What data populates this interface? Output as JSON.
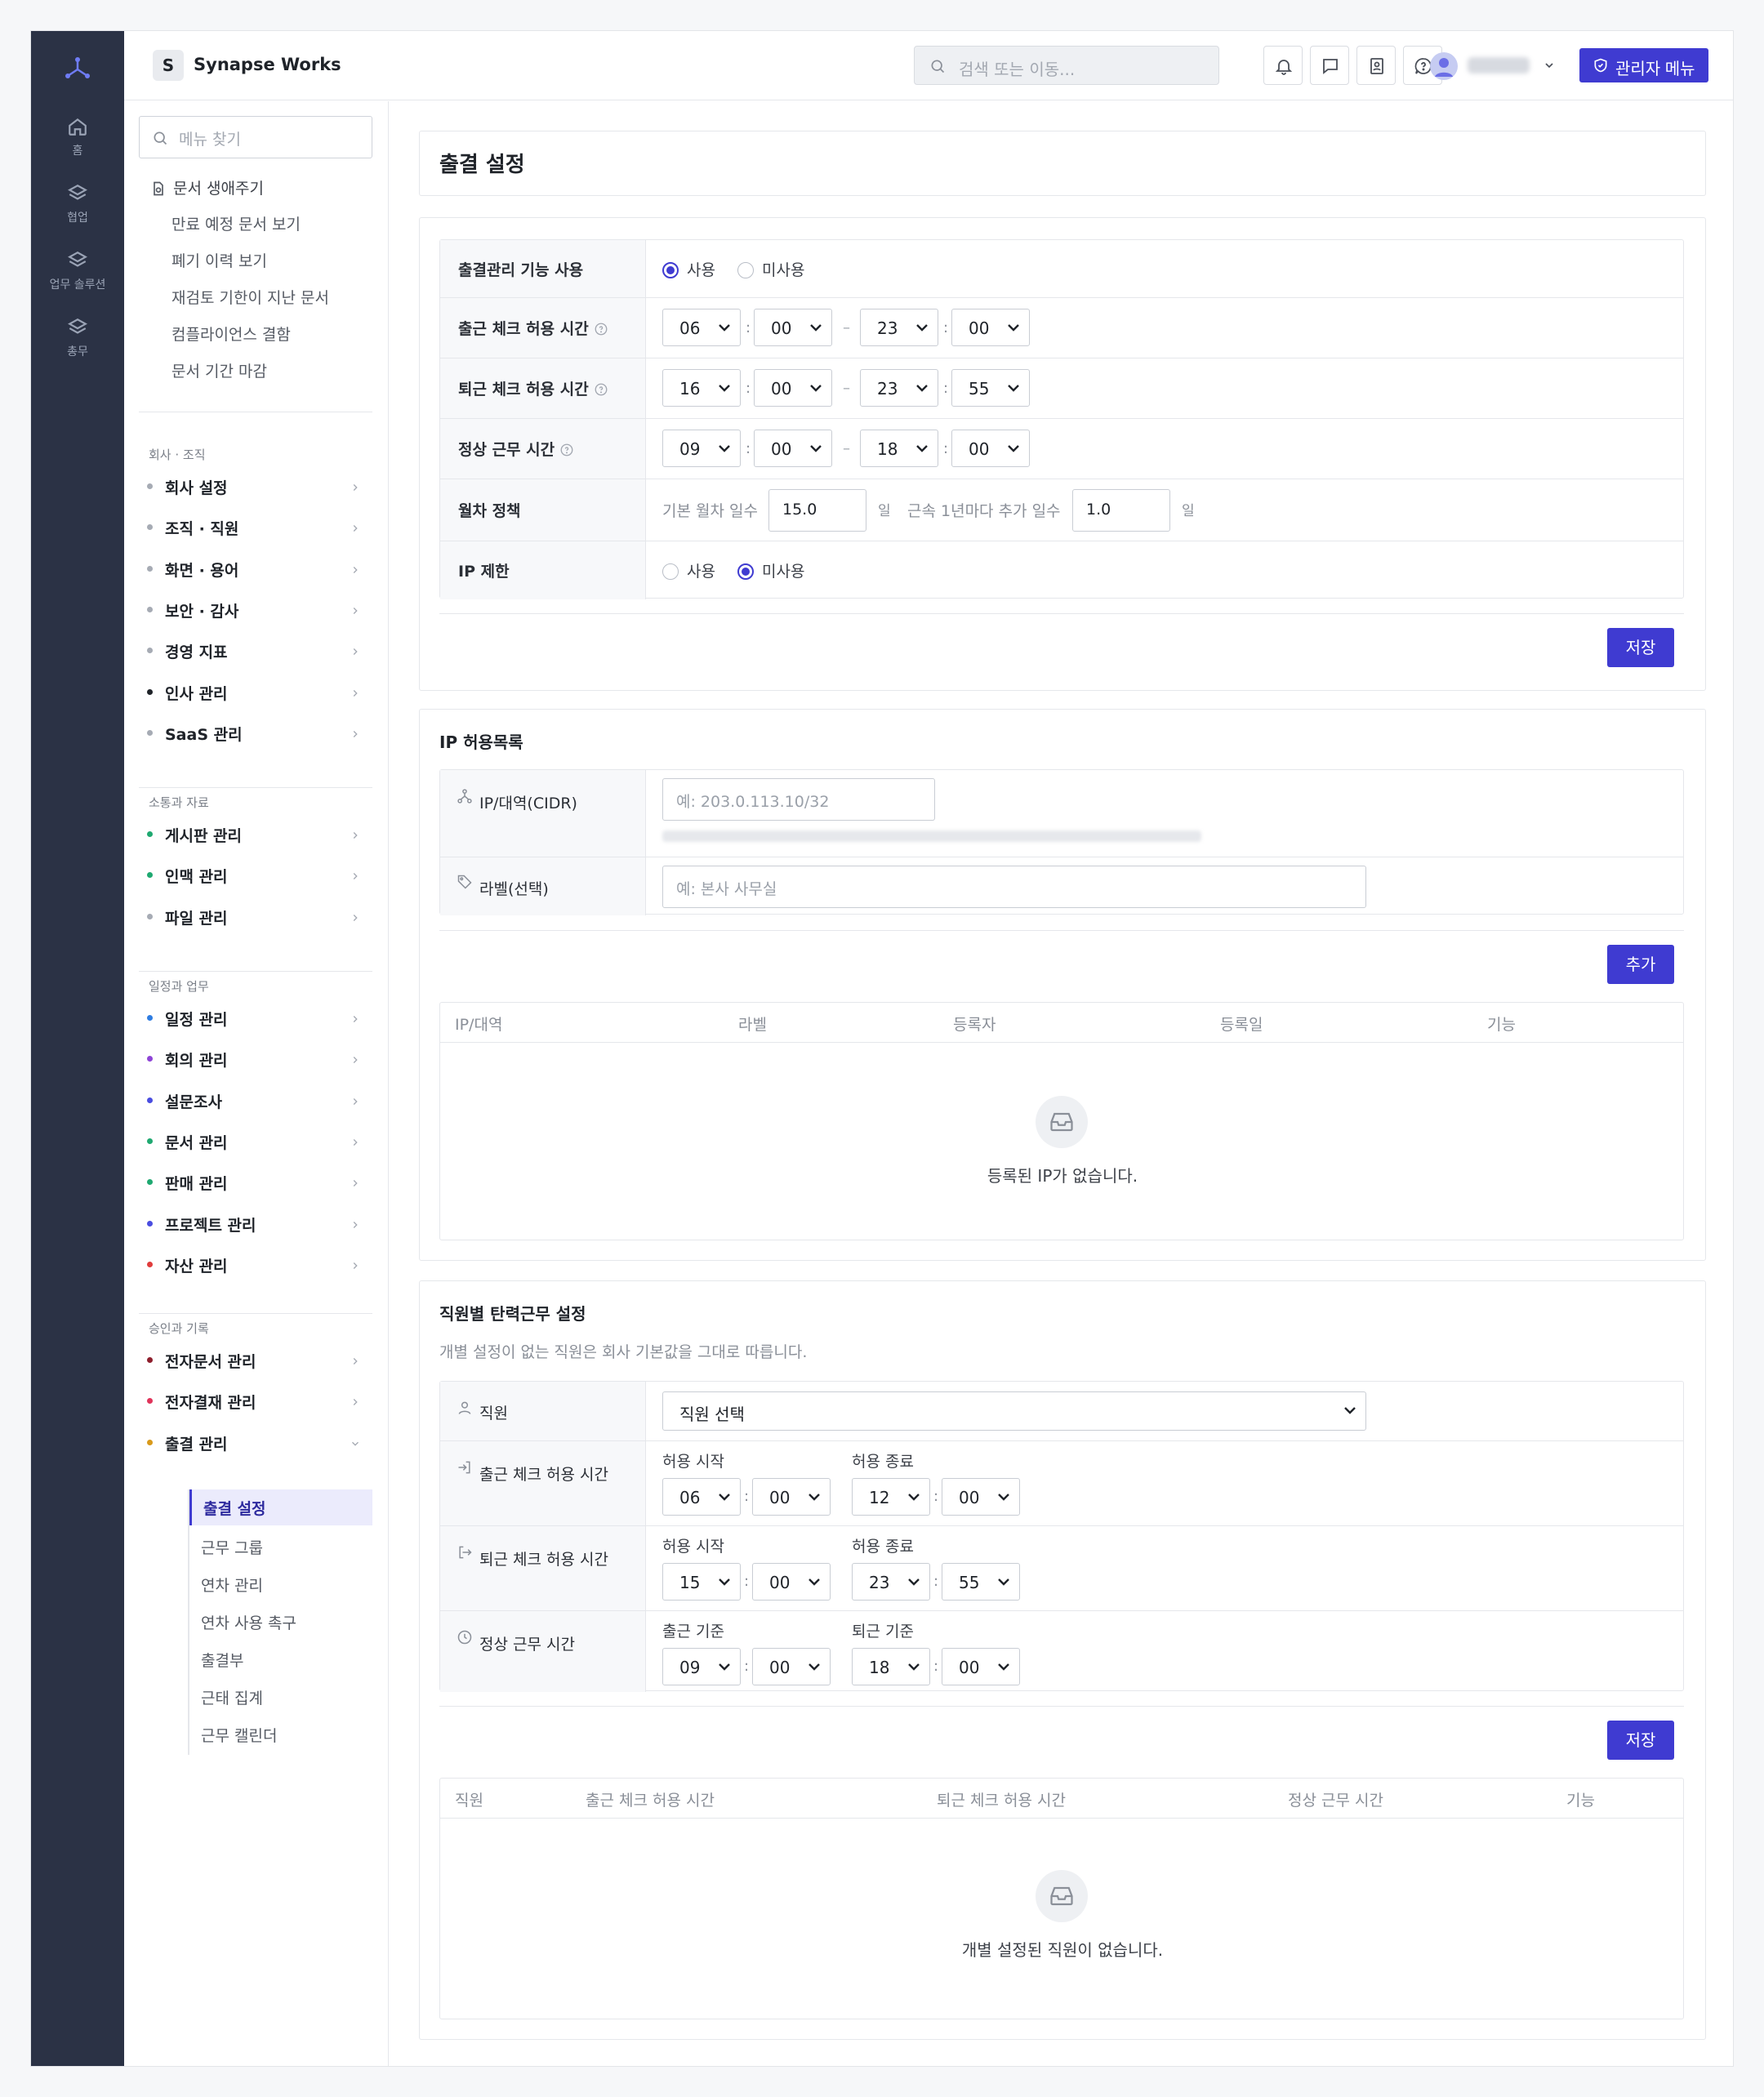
{
  "rail": {
    "items": [
      {
        "label": "홈",
        "icon": "home-icon"
      },
      {
        "label": "협업",
        "icon": "layers-icon"
      },
      {
        "label": "업무 솔루션",
        "icon": "layers-icon"
      },
      {
        "label": "총무",
        "icon": "layers-icon"
      }
    ]
  },
  "topbar": {
    "workspace_initial": "S",
    "workspace_name": "Synapse Works",
    "search_placeholder": "검색 또는 이동...",
    "admin_label": "관리자 메뉴"
  },
  "sidebar": {
    "search_placeholder": "메뉴 찾기",
    "lifecycle_title": "문서 생애주기",
    "lifecycle_items": [
      "만료 예정 문서 보기",
      "폐기 이력 보기",
      "재검토 기한이 지난 문서",
      "컴플라이언스 결함",
      "문서 기간 마감"
    ],
    "sections": [
      {
        "title": "회사 · 조직",
        "items": [
          {
            "label": "회사 설정",
            "color": "#a6abb4"
          },
          {
            "label": "조직 · 직원",
            "color": "#a6abb4"
          },
          {
            "label": "화면 · 용어",
            "color": "#a6abb4"
          },
          {
            "label": "보안 · 감사",
            "color": "#a6abb4"
          },
          {
            "label": "경영 지표",
            "color": "#a6abb4"
          },
          {
            "label": "인사 관리",
            "color": "#1f2329"
          },
          {
            "label": "SaaS 관리",
            "color": "#a6abb4"
          }
        ]
      },
      {
        "title": "소통과 자료",
        "items": [
          {
            "label": "게시판 관리",
            "color": "#1fa971"
          },
          {
            "label": "인맥 관리",
            "color": "#1fa971"
          },
          {
            "label": "파일 관리",
            "color": "#a6abb4"
          }
        ]
      },
      {
        "title": "일정과 업무",
        "items": [
          {
            "label": "일정 관리",
            "color": "#2f7de1"
          },
          {
            "label": "회의 관리",
            "color": "#8e44d6"
          },
          {
            "label": "설문조사",
            "color": "#4a4de0"
          },
          {
            "label": "문서 관리",
            "color": "#1fa971"
          },
          {
            "label": "판매 관리",
            "color": "#1fa971"
          },
          {
            "label": "프로젝트 관리",
            "color": "#4a4de0"
          },
          {
            "label": "자산 관리",
            "color": "#e03c3c"
          }
        ]
      },
      {
        "title": "승인과 기록",
        "items": [
          {
            "label": "전자문서 관리",
            "color": "#8e1f2d"
          },
          {
            "label": "전자결재 관리",
            "color": "#e0345a"
          },
          {
            "label": "출결 관리",
            "color": "#d99a1b"
          }
        ]
      }
    ],
    "attendance_sub": [
      "출결 설정",
      "근무 그룹",
      "연차 관리",
      "연차 사용 촉구",
      "출결부",
      "근태 집계",
      "근무 캘린더"
    ]
  },
  "page": {
    "title": "출결 설정"
  },
  "settings": {
    "rows": {
      "feature": {
        "label": "출결관리 기능 사용",
        "opt_on": "사용",
        "opt_off": "미사용"
      },
      "checkin": {
        "label": "출근 체크 허용 시간",
        "start_h": "06",
        "start_m": "00",
        "end_h": "23",
        "end_m": "00"
      },
      "checkout": {
        "label": "퇴근 체크 허용 시간",
        "start_h": "16",
        "start_m": "00",
        "end_h": "23",
        "end_m": "55"
      },
      "normal": {
        "label": "정상 근무 시간",
        "start_h": "09",
        "start_m": "00",
        "end_h": "18",
        "end_m": "00"
      },
      "leave": {
        "label": "월차 정책",
        "base_label": "기본 월차 일수",
        "base_value": "15.0",
        "unit": "일",
        "add_label": "근속 1년마다 추가 일수",
        "add_value": "1.0"
      },
      "ip": {
        "label": "IP 제한",
        "opt_on": "사용",
        "opt_off": "미사용"
      }
    },
    "save_label": "저장",
    "colon": ":",
    "dash": "–"
  },
  "ip_allow": {
    "title": "IP 허용목록",
    "cidr_label": "IP/대역(CIDR)",
    "cidr_placeholder": "예: 203.0.113.10/32",
    "label_label": "라벨(선택)",
    "label_placeholder": "예: 본사 사무실",
    "add_label": "추가",
    "columns": [
      "IP/대역",
      "라벨",
      "등록자",
      "등록일",
      "기능"
    ],
    "empty": "등록된 IP가 없습니다."
  },
  "flex": {
    "title": "직원별 탄력근무 설정",
    "desc": "개별 설정이 없는 직원은 회사 기본값을 그대로 따릅니다.",
    "employee_label": "직원",
    "employee_select": "직원 선택",
    "checkin": {
      "label": "출근 체크 허용 시간",
      "start_label": "허용 시작",
      "end_label": "허용 종료",
      "start_h": "06",
      "start_m": "00",
      "end_h": "12",
      "end_m": "00"
    },
    "checkout": {
      "label": "퇴근 체크 허용 시간",
      "start_label": "허용 시작",
      "end_label": "허용 종료",
      "start_h": "15",
      "start_m": "00",
      "end_h": "23",
      "end_m": "55"
    },
    "normal": {
      "label": "정상 근무 시간",
      "start_label": "출근 기준",
      "end_label": "퇴근 기준",
      "start_h": "09",
      "start_m": "00",
      "end_h": "18",
      "end_m": "00"
    },
    "save_label": "저장",
    "columns": [
      "직원",
      "출근 체크 허용 시간",
      "퇴근 체크 허용 시간",
      "정상 근무 시간",
      "기능"
    ],
    "empty": "개별 설정된 직원이 없습니다."
  }
}
